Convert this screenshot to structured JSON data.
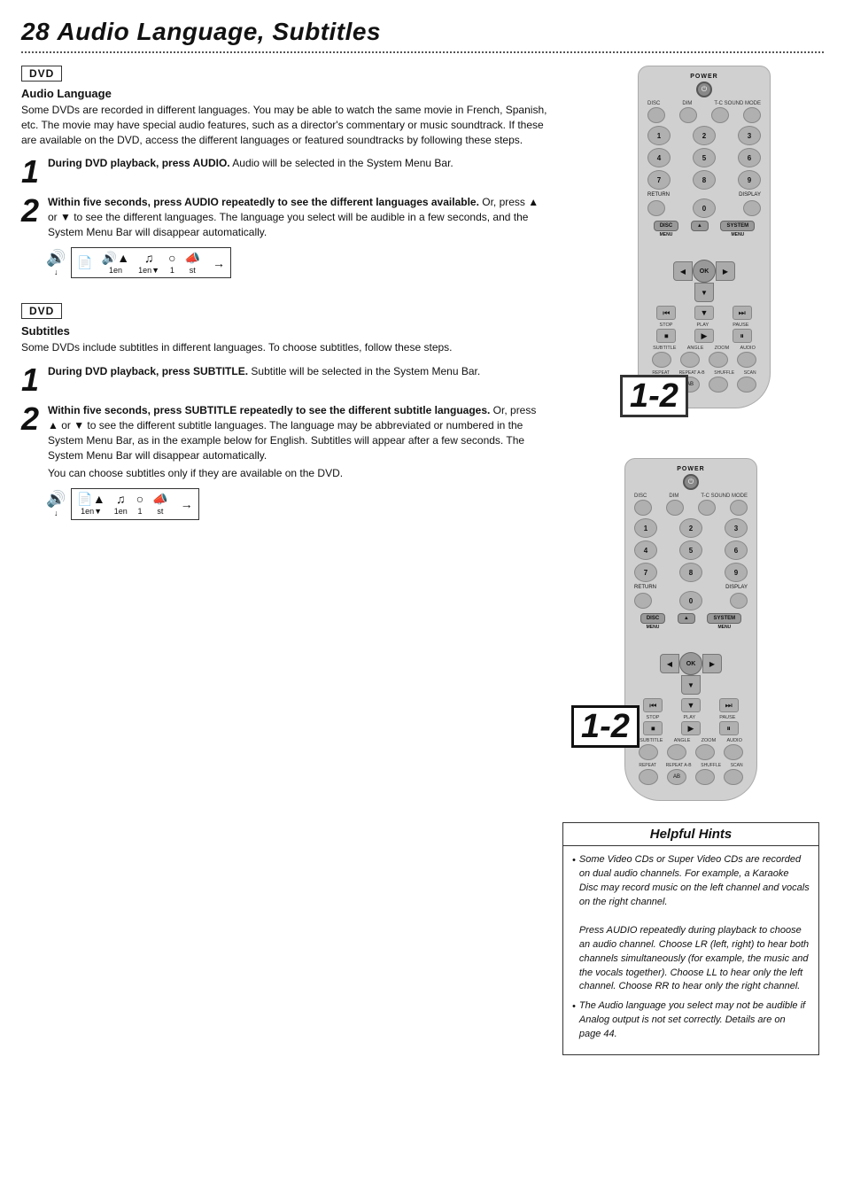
{
  "page": {
    "title_num": "28",
    "title_text": "Audio Language, Subtitles"
  },
  "section1": {
    "badge": "DVD",
    "heading": "Audio Language",
    "description": "Some DVDs are recorded in different languages. You may be able to watch the same movie in French, Spanish, etc. The movie may have special audio features, such as a director's commentary or music soundtrack. If these are available on the DVD, access the different languages or featured soundtracks by following these steps.",
    "step1_num": "1",
    "step1_text_bold": "During DVD playback, press AUDIO.",
    "step1_text_rest": " Audio will be selected in the System Menu Bar.",
    "step2_num": "2",
    "step2_text_bold": "Within five seconds, press AUDIO repeatedly to see the different languages available.",
    "step2_text_rest": " Or, press ▲ or ▼ to see the different languages. The language you select will be audible in a few seconds, and the System Menu Bar will disappear automatically.",
    "menu_labels": [
      "1en",
      "1en▼",
      "1",
      "st"
    ]
  },
  "section2": {
    "badge": "DVD",
    "heading": "Subtitles",
    "description": "Some DVDs include subtitles in different languages. To choose subtitles, follow these steps.",
    "step1_num": "1",
    "step1_text_bold": "During DVD playback, press SUBTITLE.",
    "step1_text_rest": " Subtitle will be selected in the System Menu Bar.",
    "step2_num": "2",
    "step2_text_bold": "Within five seconds, press SUBTITLE repeatedly to see the different subtitle languages.",
    "step2_text_rest": " Or, press ▲ or ▼ to see the different subtitle languages. The language may be abbreviated or numbered in the System Menu Bar, as in the example below for English. Subtitles will appear after a few seconds. The System Menu Bar will disappear automatically.",
    "step2_note": "You can choose subtitles only if they are available on the DVD.",
    "menu_labels": [
      "1en▼",
      "1en",
      "1",
      "st"
    ]
  },
  "remote": {
    "power_label": "POWER",
    "top_labels": [
      "DISC",
      "DIM",
      "T-C SOUND MODE"
    ],
    "num_row1": [
      "1",
      "2",
      "3"
    ],
    "num_row2": [
      "4",
      "5",
      "6"
    ],
    "num_row3": [
      "7",
      "8",
      "9"
    ],
    "return_label": "RETURN",
    "display_label": "DISPLAY",
    "zero": "0",
    "disc_menu": "DISC",
    "disc_menu_label": "MENU",
    "system_label": "SYSTEM",
    "system_menu_label": "MENU",
    "ok_label": "OK",
    "stop_label": "STOP",
    "play_label": "PLAY",
    "pause_label": "PAUSE",
    "bottom_labels": [
      "SUBTITLE",
      "ANGLE",
      "ZOOM",
      "AUDIO"
    ],
    "repeat_labels": [
      "REPEAT",
      "REPEAT A-B",
      "SHUFFLE",
      "SCAN"
    ]
  },
  "helpful_hints": {
    "title": "Helpful Hints",
    "hint1": "Some Video CDs or Super Video CDs are recorded on dual audio channels. For example, a Karaoke Disc may record music on the left channel and vocals on the right channel.\nPress AUDIO repeatedly during playback to choose an audio channel. Choose LR (left, right) to hear both channels simultaneously (for example, the music and the vocals together). Choose LL to hear only the left channel. Choose RR to hear only the right channel.",
    "hint2": "The Audio language you select may not be audible if Analog output is not set correctly. Details are on page 44."
  }
}
